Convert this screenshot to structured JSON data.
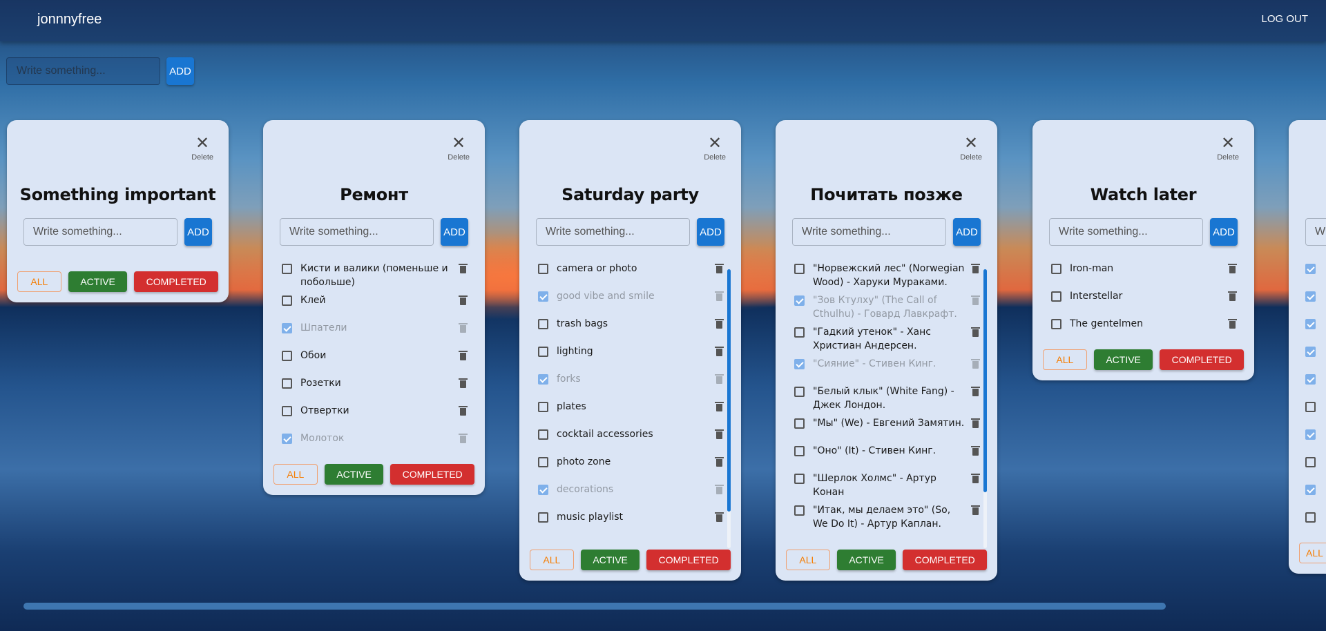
{
  "header": {
    "brand": "jonnnyfree",
    "logout": "LOG OUT"
  },
  "new_list": {
    "placeholder": "Write something...",
    "add": "ADD"
  },
  "card_labels": {
    "delete": "Delete",
    "placeholder": "Write something...",
    "add": "ADD",
    "all": "ALL",
    "active": "ACTIVE",
    "completed": "COMPLETED"
  },
  "colors": {
    "accent": "#1976d2",
    "active": "#2e7d32",
    "completed": "#d32f2f",
    "all": "#f57c00"
  },
  "lists": [
    {
      "title": "Something important",
      "items": []
    },
    {
      "title": "Ремонт",
      "items": [
        {
          "text": "Кисти и валики (поменьше и побольше)",
          "done": false
        },
        {
          "text": "Клей",
          "done": false
        },
        {
          "text": "Шпатели",
          "done": true
        },
        {
          "text": "Обои",
          "done": false
        },
        {
          "text": "Розетки",
          "done": false
        },
        {
          "text": "Отвертки",
          "done": false
        },
        {
          "text": "Молоток",
          "done": true
        }
      ]
    },
    {
      "title": "Saturday party",
      "scroll": {
        "thumb_start": 0,
        "thumb_fraction": 0.87
      },
      "items": [
        {
          "text": "camera or photo",
          "done": false
        },
        {
          "text": "good vibe and smile",
          "done": true
        },
        {
          "text": "trash bags",
          "done": false
        },
        {
          "text": "lighting",
          "done": false
        },
        {
          "text": "forks",
          "done": true
        },
        {
          "text": "plates",
          "done": false
        },
        {
          "text": "cocktail accessories",
          "done": false
        },
        {
          "text": "photo zone",
          "done": false
        },
        {
          "text": "decorations",
          "done": true
        },
        {
          "text": "music playlist",
          "done": false
        }
      ]
    },
    {
      "title": "Почитать позже",
      "scroll": {
        "thumb_start": 0,
        "thumb_fraction": 0.8
      },
      "items": [
        {
          "text": "\"Норвежский лес\" (Norwegian Wood) - Харуки Мураками.",
          "done": false
        },
        {
          "text": "\"Зов Ктулху\" (The Call of Cthulhu) - Говард Лавкрафт.",
          "done": true
        },
        {
          "text": "\"Гадкий утенок\" - Ханс Христиан Андерсен.",
          "done": false
        },
        {
          "text": "\"Сияние\" - Стивен Кинг.",
          "done": true
        },
        {
          "text": "\"Белый клык\" (White Fang) - Джек Лондон.",
          "done": false
        },
        {
          "text": "\"Мы\" (We) - Евгений Замятин.",
          "done": false
        },
        {
          "text": "\"Оно\" (It) - Стивен Кинг.",
          "done": false
        },
        {
          "text": "\"Шерлок Холмс\" - Артур Конан",
          "done": false
        },
        {
          "text": "\"Итак, мы делаем это\" (So, We Do It) - Артур Каплан.",
          "done": false
        }
      ]
    },
    {
      "title": "Watch later",
      "items": [
        {
          "text": "Iron-man",
          "done": false
        },
        {
          "text": "Interstellar",
          "done": false
        },
        {
          "text": "The gentelmen",
          "done": false
        }
      ]
    },
    {
      "title": "",
      "items": [
        {
          "text": "",
          "done": true
        },
        {
          "text": "",
          "done": true
        },
        {
          "text": "",
          "done": true
        },
        {
          "text": "",
          "done": true
        },
        {
          "text": "",
          "done": true
        },
        {
          "text": "",
          "done": false
        },
        {
          "text": "",
          "done": true
        },
        {
          "text": "",
          "done": false
        },
        {
          "text": "",
          "done": true
        },
        {
          "text": "",
          "done": false
        }
      ]
    }
  ]
}
